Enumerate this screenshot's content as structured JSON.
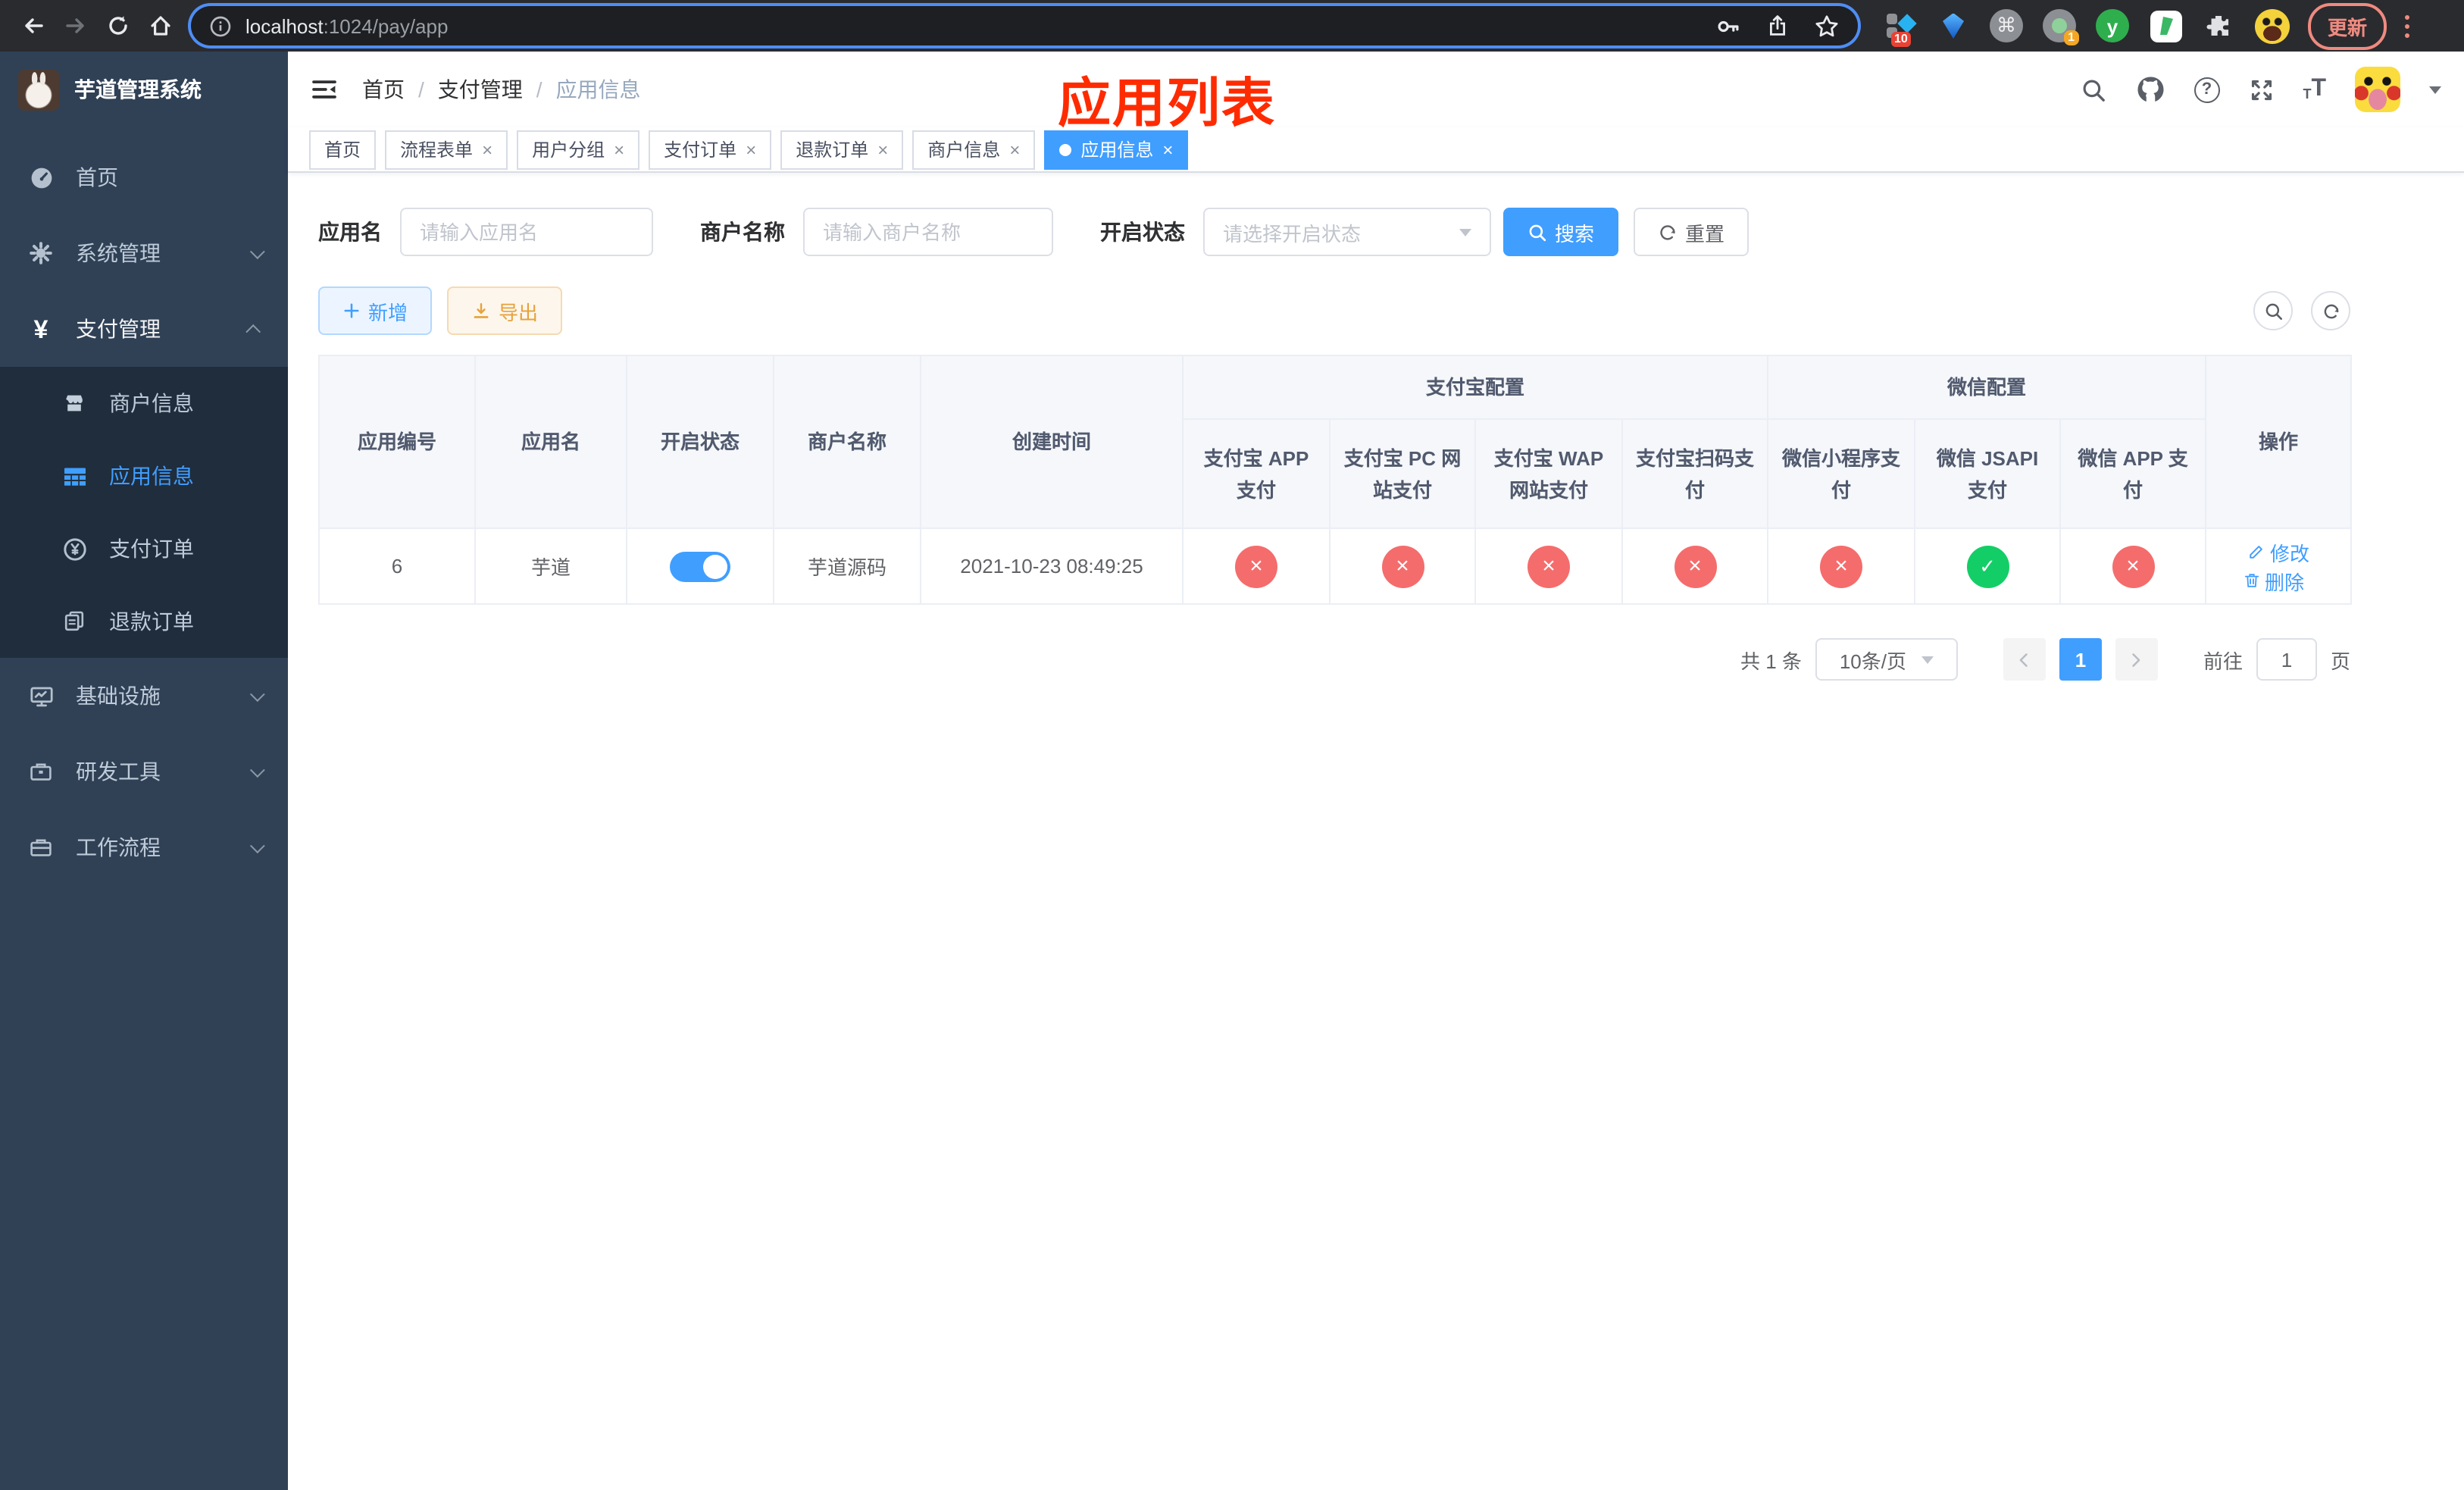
{
  "browser": {
    "url": {
      "host": "localhost",
      "path": ":1024/pay/app"
    },
    "update_label": "更新",
    "ext_badge_red": "10",
    "ext_badge_orange": "1",
    "glyphs": {
      "command": "⌘",
      "yuque": "y",
      "question": "?"
    }
  },
  "sidebar": {
    "logo_title": "芋道管理系统",
    "yen_glyph": "¥",
    "items": [
      {
        "label": "首页"
      },
      {
        "label": "系统管理"
      },
      {
        "label": "支付管理"
      },
      {
        "label": "基础设施"
      },
      {
        "label": "研发工具"
      },
      {
        "label": "工作流程"
      }
    ],
    "payment_children": [
      {
        "label": "商户信息"
      },
      {
        "label": "应用信息"
      },
      {
        "label": "支付订单"
      },
      {
        "label": "退款订单"
      }
    ]
  },
  "navbar": {
    "breadcrumb": [
      "首页",
      "支付管理",
      "应用信息"
    ],
    "separator": "/"
  },
  "overlay_title": "应用列表",
  "tabs": [
    {
      "label": "首页"
    },
    {
      "label": "流程表单"
    },
    {
      "label": "用户分组"
    },
    {
      "label": "支付订单"
    },
    {
      "label": "退款订单"
    },
    {
      "label": "商户信息"
    },
    {
      "label": "应用信息"
    }
  ],
  "filters": {
    "app_name_label": "应用名",
    "app_name_placeholder": "请输入应用名",
    "merchant_label": "商户名称",
    "merchant_placeholder": "请输入商户名称",
    "status_label": "开启状态",
    "status_placeholder": "请选择开启状态",
    "search_label": "搜索",
    "reset_label": "重置"
  },
  "toolbar": {
    "add_label": "新增",
    "export_label": "导出"
  },
  "table": {
    "columns": [
      "应用编号",
      "应用名",
      "开启状态",
      "商户名称",
      "创建时间"
    ],
    "groups": [
      {
        "label": "支付宝配置"
      },
      {
        "label": "微信配置"
      }
    ],
    "sub_columns": [
      "支付宝 APP 支付",
      "支付宝 PC 网站支付",
      "支付宝 WAP 网站支付",
      "支付宝扫码支付",
      "微信小程序支付",
      "微信 JSAPI 支付",
      "微信 APP 支付"
    ],
    "actions_label": "操作",
    "rows": [
      {
        "id": "6",
        "name": "芋道",
        "enabled": "on",
        "merchant": "芋道源码",
        "created": "2021-10-23 08:49:25",
        "configs": [
          "disabled",
          "disabled",
          "disabled",
          "disabled",
          "disabled",
          "enabled",
          "disabled"
        ],
        "edit_label": "修改",
        "delete_label": "删除"
      }
    ]
  },
  "pagination": {
    "total": "共 1 条",
    "page_size": "10条/页",
    "current_page": "1",
    "goto_prefix": "前往",
    "goto_value": "1",
    "goto_suffix": "页"
  }
}
